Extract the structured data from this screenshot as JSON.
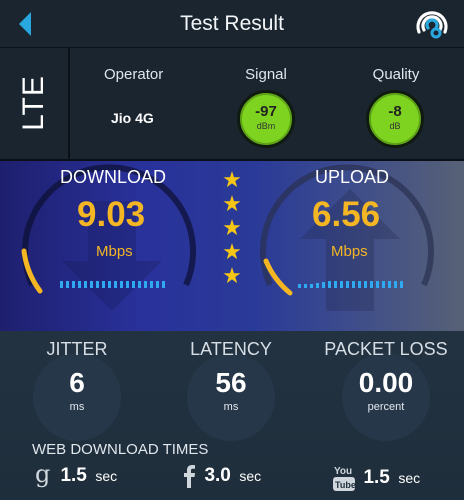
{
  "header": {
    "title": "Test Result",
    "back_icon": "back-arrow-icon",
    "action_icon": "signal-broadcast-icon",
    "accent": "#29a8e0"
  },
  "network": {
    "type": "LTE",
    "operator_label": "Operator",
    "operator_value": "Jio 4G",
    "signal_label": "Signal",
    "signal_value": "-97",
    "signal_unit": "dBm",
    "quality_label": "Quality",
    "quality_value": "-8",
    "quality_unit": "dB",
    "indicator_color": "#7ed321"
  },
  "speed": {
    "download_label": "DOWNLOAD",
    "download_value": "9.03",
    "download_unit": "Mbps",
    "upload_label": "UPLOAD",
    "upload_value": "6.56",
    "upload_unit": "Mbps",
    "rating_stars": 5,
    "value_color": "#f5b623"
  },
  "stats": {
    "jitter_label": "JITTER",
    "jitter_value": "6",
    "jitter_unit": "ms",
    "latency_label": "LATENCY",
    "latency_value": "56",
    "latency_unit": "ms",
    "packet_loss_label": "PACKET LOSS",
    "packet_loss_value": "0.00",
    "packet_loss_unit": "percent"
  },
  "web_download": {
    "label": "WEB DOWNLOAD TIMES",
    "items": [
      {
        "icon": "google-icon",
        "value": "1.5",
        "unit": "sec"
      },
      {
        "icon": "facebook-icon",
        "value": "3.0",
        "unit": "sec"
      },
      {
        "icon": "youtube-icon",
        "value": "1.5",
        "unit": "sec"
      }
    ]
  }
}
